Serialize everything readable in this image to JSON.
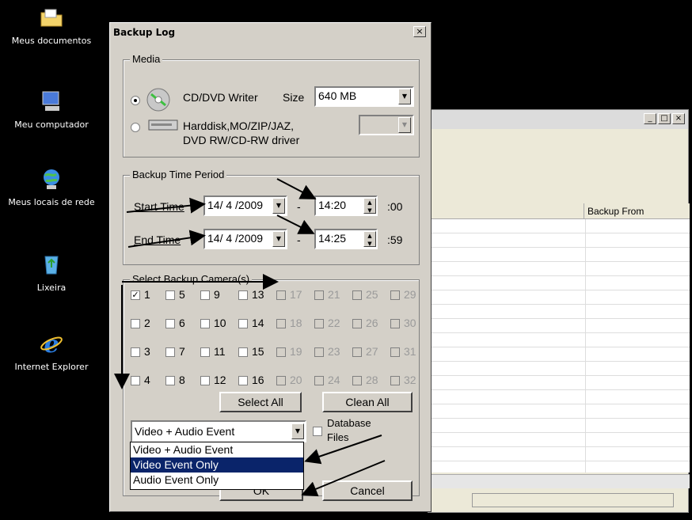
{
  "desktop": {
    "icons": [
      {
        "label": "Meus documentos",
        "icon": "folder-icon"
      },
      {
        "label": "Meu computador",
        "icon": "computer-icon"
      },
      {
        "label": "Meus locais de rede",
        "icon": "network-icon"
      },
      {
        "label": "Lixeira",
        "icon": "recycle-bin-icon"
      },
      {
        "label": "Internet Explorer",
        "icon": "internet-explorer-icon"
      }
    ]
  },
  "background_window": {
    "min": "_",
    "max": "□",
    "close": "×",
    "column_header": "Backup From"
  },
  "dialog": {
    "title": "Backup Log",
    "close": "×",
    "media": {
      "label": "Media",
      "cd_label": "CD/DVD Writer",
      "size_label": "Size",
      "size_value": "640 MB",
      "hdd_label_1": "Harddisk,MO/ZIP/JAZ,",
      "hdd_label_2": "DVD RW/CD-RW driver",
      "selected": "cd"
    },
    "period": {
      "label": "Backup Time Period",
      "start_label": "Start Time",
      "start_date": "14/ 4 /2009",
      "dash": "-",
      "start_time": "14:20",
      "start_sec": ":00",
      "end_label": "End Time",
      "end_date": "14/ 4 /2009",
      "end_time": "14:25",
      "end_sec": ":59"
    },
    "cameras": {
      "label": "Select Backup Camera(s)",
      "items": [
        "1",
        "5",
        "9",
        "13",
        "17",
        "21",
        "25",
        "29",
        "2",
        "6",
        "10",
        "14",
        "18",
        "22",
        "26",
        "30",
        "3",
        "7",
        "11",
        "15",
        "19",
        "23",
        "27",
        "31",
        "4",
        "8",
        "12",
        "16",
        "20",
        "24",
        "28",
        "32"
      ],
      "checked": [
        "1"
      ],
      "select_all": "Select All",
      "clean_all": "Clean All"
    },
    "event": {
      "value": "Video + Audio Event",
      "options": [
        "Video + Audio Event",
        "Video Event Only",
        "Audio Event Only"
      ],
      "highlighted": "Video Event Only",
      "database_label_1": "Database",
      "database_label_2": "Files"
    },
    "ok": "OK",
    "cancel": "Cancel"
  }
}
